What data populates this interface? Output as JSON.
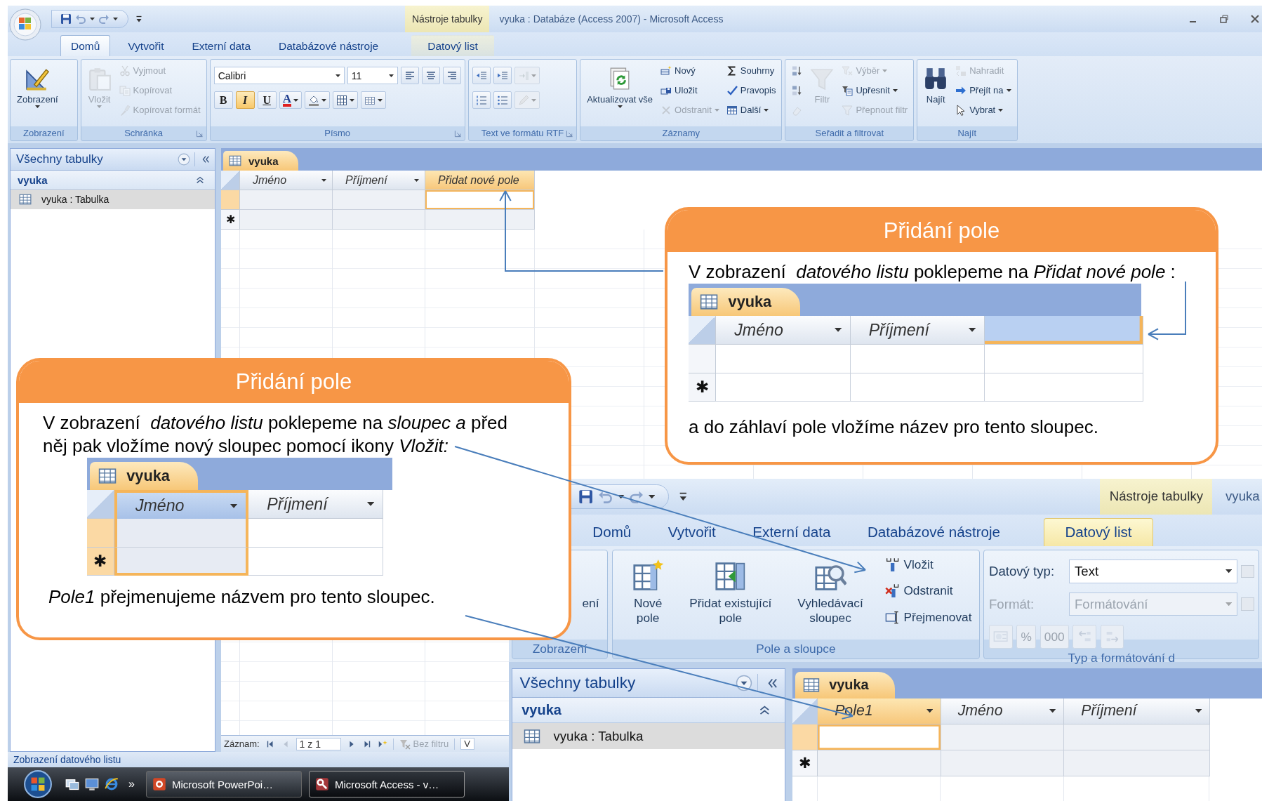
{
  "window": {
    "title": "vyuka : Databáze (Access 2007) - Microsoft Access",
    "context_tab": "Nástroje tabulky"
  },
  "ribbon": {
    "tabs": [
      {
        "label": "Domů",
        "selected": true,
        "contextual": false
      },
      {
        "label": "Vytvořit",
        "selected": false,
        "contextual": false
      },
      {
        "label": "Externí data",
        "selected": false,
        "contextual": false
      },
      {
        "label": "Databázové nástroje",
        "selected": false,
        "contextual": false
      },
      {
        "label": "Datový list",
        "selected": false,
        "contextual": true
      }
    ],
    "groups": [
      {
        "label": "Zobrazení",
        "launcher": false,
        "columns": [
          [
            {
              "kind": "large",
              "label": "Zobrazení",
              "dropdown": true,
              "disabled": false
            }
          ]
        ]
      },
      {
        "label": "Schránka",
        "launcher": true,
        "columns": [
          [
            {
              "kind": "large",
              "label": "Vložit",
              "dropdown": true,
              "disabled": true
            }
          ],
          [
            {
              "kind": "small",
              "label": "Vyjmout",
              "dropdown": false,
              "disabled": true
            },
            {
              "kind": "small",
              "label": "Kopírovat",
              "dropdown": false,
              "disabled": true
            },
            {
              "kind": "small",
              "label": "Kopírovat formát",
              "dropdown": false,
              "disabled": true
            }
          ]
        ]
      },
      {
        "label": "Písmo",
        "launcher": true,
        "lines": [
          [
            {
              "kind": "font-combo",
              "value": "Calibri",
              "disabled": false
            },
            {
              "kind": "size-combo",
              "value": "11",
              "disabled": false
            },
            {
              "kind": "icon",
              "dropdown": false,
              "disabled": false
            },
            {
              "kind": "icon",
              "dropdown": false,
              "disabled": false
            },
            {
              "kind": "icon",
              "dropdown": false,
              "disabled": false
            }
          ],
          [
            {
              "kind": "toggle",
              "label": "B",
              "on": false,
              "disabled": false
            },
            {
              "kind": "toggle",
              "label": "I",
              "on": true,
              "disabled": false
            },
            {
              "kind": "toggle",
              "label": "U",
              "on": false,
              "disabled": false
            },
            {
              "kind": "icon",
              "label": "A",
              "dropdown": true,
              "disabled": false
            },
            {
              "kind": "icon",
              "dropdown": true,
              "disabled": false
            },
            {
              "kind": "icon",
              "dropdown": true,
              "disabled": false
            },
            {
              "kind": "icon",
              "dropdown": true,
              "disabled": false
            }
          ]
        ]
      },
      {
        "label": "Text ve formátu RTF",
        "launcher": true,
        "lines": [
          [
            {
              "kind": "icon",
              "dropdown": false,
              "disabled": false
            },
            {
              "kind": "icon",
              "dropdown": false,
              "disabled": false
            },
            {
              "kind": "icon",
              "dropdown": true,
              "disabled": true
            }
          ],
          [
            {
              "kind": "icon",
              "dropdown": false,
              "disabled": false
            },
            {
              "kind": "icon",
              "dropdown": false,
              "disabled": false
            },
            {
              "kind": "icon",
              "dropdown": true,
              "disabled": true
            }
          ]
        ]
      },
      {
        "label": "Záznamy",
        "launcher": false,
        "columns": [
          [
            {
              "kind": "large",
              "label": "Aktualizovat vše",
              "dropdown": true,
              "disabled": false
            }
          ],
          [
            {
              "kind": "small",
              "label": "Nový",
              "dropdown": false,
              "disabled": false
            },
            {
              "kind": "small",
              "label": "Uložit",
              "dropdown": false,
              "disabled": false
            },
            {
              "kind": "small",
              "label": "Odstranit",
              "dropdown": true,
              "disabled": true
            }
          ],
          [
            {
              "kind": "small",
              "label": "Souhrny",
              "dropdown": false,
              "disabled": false
            },
            {
              "kind": "small",
              "label": "Pravopis",
              "dropdown": false,
              "disabled": false
            },
            {
              "kind": "small",
              "label": "Další",
              "dropdown": true,
              "disabled": false
            }
          ]
        ]
      },
      {
        "label": "Seřadit a filtrovat",
        "launcher": false,
        "columns": [
          [
            {
              "kind": "small",
              "dropdown": false,
              "disabled": false
            },
            {
              "kind": "small",
              "dropdown": false,
              "disabled": false
            },
            {
              "kind": "small",
              "dropdown": false,
              "disabled": true
            }
          ],
          [
            {
              "kind": "large",
              "label": "Filtr",
              "dropdown": false,
              "disabled": true
            }
          ],
          [
            {
              "kind": "small",
              "label": "Výběr",
              "dropdown": true,
              "disabled": true
            },
            {
              "kind": "small",
              "label": "Upřesnit",
              "dropdown": true,
              "disabled": false
            },
            {
              "kind": "small",
              "label": "Přepnout filtr",
              "dropdown": false,
              "disabled": true
            }
          ]
        ]
      },
      {
        "label": "Najít",
        "launcher": false,
        "columns": [
          [
            {
              "kind": "large",
              "label": "Najít",
              "dropdown": false,
              "disabled": false
            }
          ],
          [
            {
              "kind": "small",
              "label": "Nahradit",
              "dropdown": false,
              "disabled": true
            },
            {
              "kind": "small",
              "label": "Přejít na",
              "dropdown": true,
              "disabled": false
            },
            {
              "kind": "small",
              "label": "Vybrat",
              "dropdown": true,
              "disabled": false
            }
          ]
        ]
      }
    ]
  },
  "navigation": {
    "title": "Všechny tabulky",
    "groups": [
      {
        "label": "vyuka",
        "expanded": true,
        "items": [
          {
            "label": "vyuka : Tabulka",
            "selected": true
          }
        ]
      }
    ]
  },
  "datasheet": {
    "tab": "vyuka",
    "columns": [
      {
        "label": "Jméno",
        "dropdown": true,
        "selected": false
      },
      {
        "label": "Příjmení",
        "dropdown": true,
        "selected": false
      },
      {
        "label": "Přidat nové pole",
        "dropdown": false,
        "selected": true
      }
    ],
    "rows": [
      {
        "selected": true
      },
      {
        "marker": "✱",
        "selected": false
      }
    ]
  },
  "record_navigator": {
    "label": "Záznam:",
    "position": "1 z 1",
    "filter": "Bez filtru",
    "search": "V"
  },
  "status_bar": "Zobrazení datového listu",
  "taskbar": {
    "more": "»",
    "buttons": [
      {
        "label": "Microsoft PowerPoi…",
        "selected": false
      },
      {
        "label": "Microsoft Access - v…",
        "selected": true
      }
    ]
  },
  "callouts": [
    {
      "title": "Přidání pole",
      "text": "V zobrazení  *datového listu* poklepeme na *Přidat nové pole* :",
      "datasheet": {
        "tab": "vyuka",
        "columns": [
          {
            "label": "Jméno",
            "dropdown": true,
            "selected": false
          },
          {
            "label": "Příjmení",
            "dropdown": true,
            "selected": false
          },
          {
            "dropdown": false,
            "selected": true
          }
        ],
        "rows": [
          {
            "selected": false
          },
          {
            "marker": "✱",
            "selected": false
          }
        ]
      },
      "note": "a do záhlaví pole vložíme název pro tento sloupec."
    },
    {
      "title": "Přidání pole",
      "text": "V zobrazení  *datového listu* poklepeme na *sloupec a* před něj pak vložíme nový sloupec pomocí ikony *Vložit:*",
      "datasheet": {
        "tab": "vyuka",
        "columns": [
          {
            "label": "Jméno",
            "dropdown": true,
            "selected": true
          },
          {
            "label": "Příjmení",
            "dropdown": true,
            "selected": false
          }
        ],
        "rows": [
          {
            "selected": true
          },
          {
            "marker": "✱",
            "selected": true
          }
        ]
      },
      "note": "*Pole1* přejmenujeme názvem pro tento sloupec."
    }
  ],
  "inset_window": {
    "context_tab": "Nástroje tabulky",
    "title": "vyuka",
    "tabs": [
      {
        "label": "Domů",
        "selected": false,
        "contextual": false
      },
      {
        "label": "Vytvořit",
        "selected": false,
        "contextual": false
      },
      {
        "label": "Externí data",
        "selected": false,
        "contextual": false
      },
      {
        "label": "Databázové nástroje",
        "selected": false,
        "contextual": false
      },
      {
        "label": "Datový list",
        "selected": true,
        "contextual": true
      }
    ],
    "groups": [
      {
        "label": "Zobrazení",
        "launcher": false,
        "columns": [
          [
            {
              "kind": "large",
              "label": "ení",
              "dropdown": false,
              "disabled": false
            }
          ]
        ]
      },
      {
        "label": "Pole a sloupce",
        "launcher": false,
        "columns": [
          [
            {
              "kind": "large",
              "label": "Nové pole",
              "dropdown": false,
              "disabled": false
            }
          ],
          [
            {
              "kind": "large",
              "label": "Přidat existující pole",
              "dropdown": false,
              "disabled": false
            }
          ],
          [
            {
              "kind": "large",
              "label": "Vyhledávací sloupec",
              "dropdown": false,
              "disabled": false
            }
          ],
          [
            {
              "kind": "small",
              "label": "Vložit",
              "dropdown": false,
              "disabled": false
            },
            {
              "kind": "small",
              "label": "Odstranit",
              "dropdown": false,
              "disabled": false
            },
            {
              "kind": "small",
              "label": "Přejmenovat",
              "dropdown": false,
              "disabled": false
            }
          ]
        ]
      },
      {
        "label": "Typ a formátování d",
        "launcher": false,
        "lines": [
          [
            {
              "kind": "text",
              "label": "Datový typ:",
              "disabled": false
            },
            {
              "kind": "field-combo",
              "value": "Text",
              "disabled": false
            },
            {
              "kind": "checkbox",
              "checked": false,
              "disabled": true
            }
          ],
          [
            {
              "kind": "text",
              "label": "Formát:",
              "disabled": true
            },
            {
              "kind": "field-combo",
              "value": "Formátování",
              "disabled": true
            },
            {
              "kind": "checkbox",
              "checked": false,
              "disabled": true
            }
          ],
          [
            {
              "kind": "icon",
              "dropdown": false,
              "disabled": true
            },
            {
              "kind": "icon",
              "label": "%",
              "dropdown": false,
              "disabled": true
            },
            {
              "kind": "icon",
              "label": "000",
              "dropdown": false,
              "disabled": true
            },
            {
              "kind": "icon",
              "dropdown": false,
              "disabled": true
            },
            {
              "kind": "icon",
              "dropdown": false,
              "disabled": true
            }
          ]
        ]
      }
    ],
    "navigation": {
      "title": "Všechny tabulky",
      "groups": [
        {
          "label": "vyuka",
          "expanded": true,
          "items": [
            {
              "label": "vyuka : Tabulka",
              "selected": true
            }
          ]
        }
      ]
    },
    "datasheet": {
      "tab": "vyuka",
      "columns": [
        {
          "label": "Pole1",
          "dropdown": true,
          "selected": true
        },
        {
          "label": "Jméno",
          "dropdown": true,
          "selected": false
        },
        {
          "label": "Příjmení",
          "dropdown": true,
          "selected": false
        }
      ],
      "rows": [
        {
          "selected": true
        },
        {
          "marker": "✱",
          "selected": false
        }
      ]
    }
  }
}
